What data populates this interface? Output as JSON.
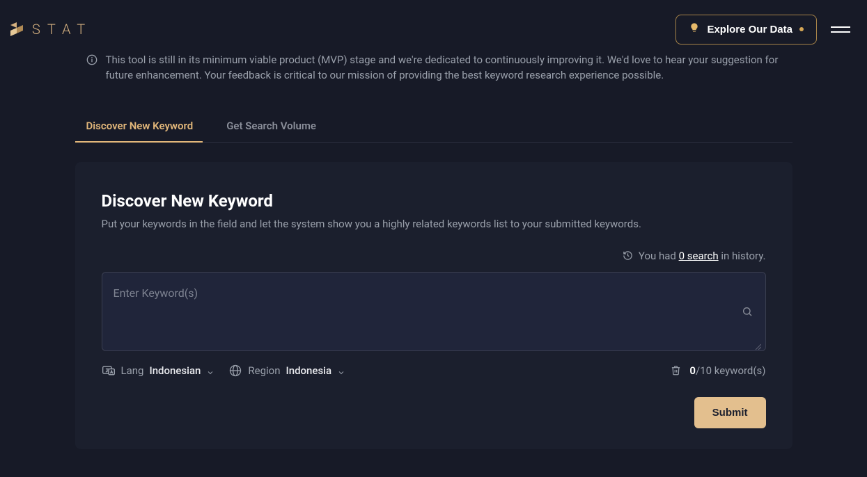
{
  "header": {
    "brand": "STAT",
    "explore_label": "Explore Our Data"
  },
  "notice": {
    "text": "This tool is still in its minimum viable product (MVP) stage and we're dedicated to continuously improving it. We'd love to hear your suggestion for future enhancement. Your feedback is critical to our mission of providing the best keyword research experience possible."
  },
  "tabs": {
    "discover": "Discover New Keyword",
    "volume": "Get Search Volume"
  },
  "panel": {
    "title": "Discover New Keyword",
    "description": "Put your keywords in the field and let the system show you a highly related keywords list to your submitted keywords."
  },
  "history": {
    "prefix": "You had ",
    "link": "0 search",
    "suffix": " in history."
  },
  "input": {
    "placeholder": "Enter Keyword(s)"
  },
  "controls": {
    "lang_label": "Lang",
    "lang_value": "Indonesian",
    "region_label": "Region",
    "region_value": "Indonesia",
    "count_current": "0",
    "count_max": "/10 keyword(s)"
  },
  "submit": {
    "label": "Submit"
  }
}
